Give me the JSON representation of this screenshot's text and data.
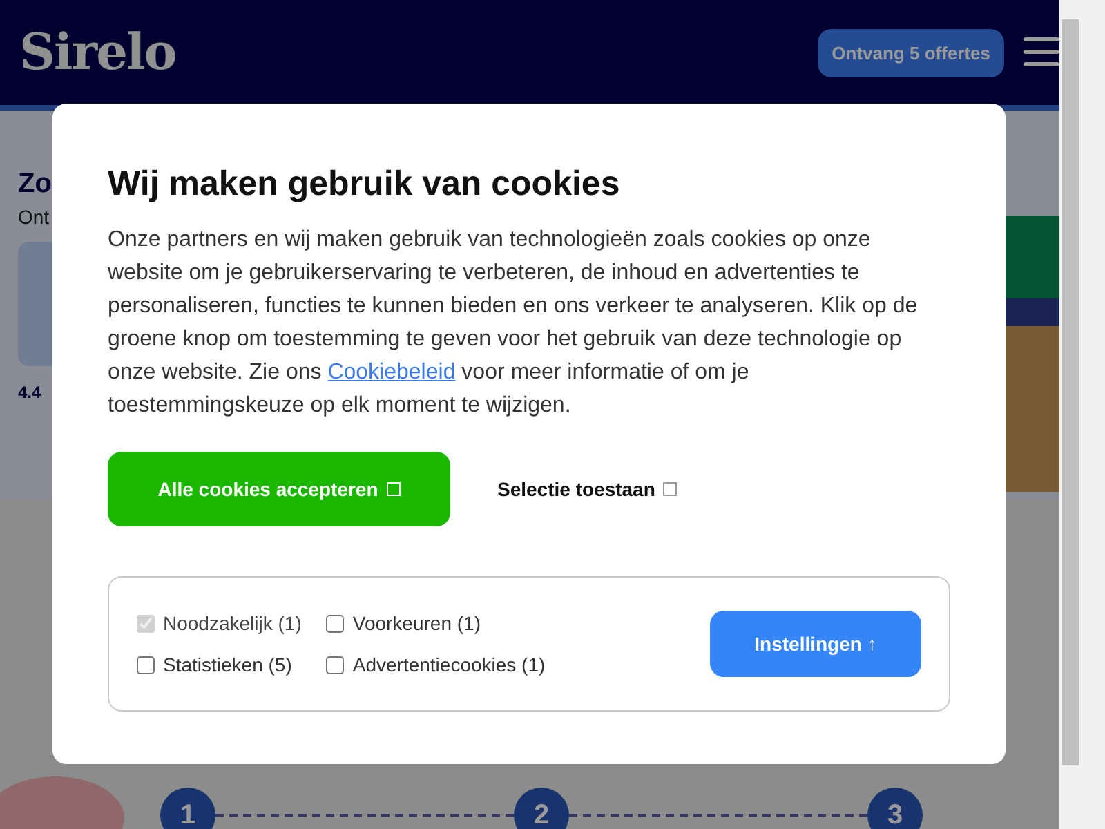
{
  "header": {
    "logo": "Sirelo",
    "cta": "Ontvang 5 offertes"
  },
  "background": {
    "heading": "Zo",
    "subheading": "Ont",
    "rating": "4.4",
    "steps": [
      "1",
      "2",
      "3"
    ]
  },
  "dialog": {
    "title": "Wij maken gebruik van cookies",
    "text_before": "Onze partners en wij maken gebruik van technologieën zoals cookies op onze website om je gebruikerservaring te verbeteren, de inhoud en advertenties te personaliseren, functies te kunnen bieden en ons verkeer te analyseren. Klik op de groene knop om toestemming te geven voor het gebruik van deze technologie op onze website. Zie ons",
    "link": "Cookiebeleid",
    "text_after": "voor meer informatie of om je toestemmingskeuze op elk moment te wijzigen.",
    "accept_button": "Alle cookies accepteren",
    "selection_button": "Selectie toestaan",
    "options": [
      {
        "label": "Noodzakelijk (1)",
        "checked": true,
        "disabled": true
      },
      {
        "label": "Voorkeuren (1)",
        "checked": false,
        "disabled": false
      },
      {
        "label": "Statistieken (5)",
        "checked": false,
        "disabled": false
      },
      {
        "label": "Advertentiecookies (1)",
        "checked": false,
        "disabled": false
      }
    ],
    "settings_button": "Instellingen ↑"
  }
}
